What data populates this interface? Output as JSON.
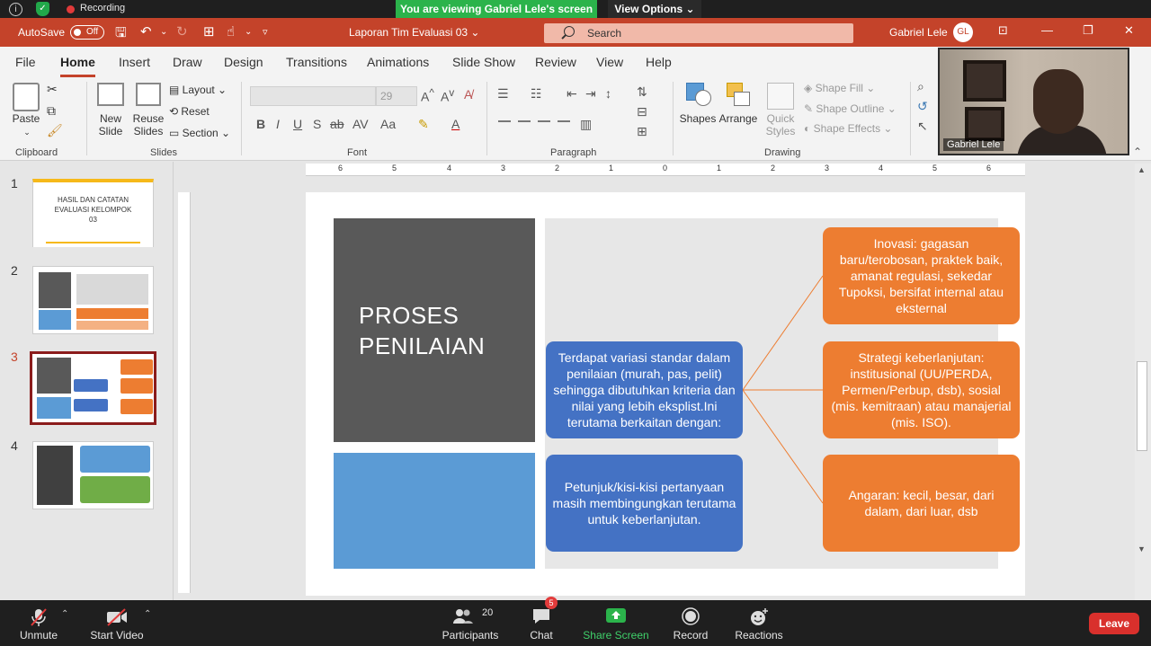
{
  "zoom": {
    "recording_label": "Recording",
    "viewing_banner": "You are viewing Gabriel Lele's screen",
    "view_options": "View Options",
    "toolbar": {
      "unmute": "Unmute",
      "start_video": "Start Video",
      "participants": "Participants",
      "participants_count": "20",
      "chat": "Chat",
      "chat_badge": "5",
      "share_screen": "Share Screen",
      "record": "Record",
      "reactions": "Reactions",
      "leave": "Leave"
    },
    "webcam_name": "Gabriel Lele"
  },
  "ppt": {
    "autosave_label": "AutoSave",
    "autosave_state": "Off",
    "doc_title": "Laporan Tim Evaluasi 03",
    "search_placeholder": "Search",
    "user_name": "Gabriel Lele",
    "user_initials": "GL",
    "tabs": [
      "File",
      "Home",
      "Insert",
      "Draw",
      "Design",
      "Transitions",
      "Animations",
      "Slide Show",
      "Review",
      "View",
      "Help"
    ],
    "ribbon": {
      "paste": "Paste",
      "new_slide": "New Slide",
      "reuse_slides": "Reuse Slides",
      "layout": "Layout",
      "reset": "Reset",
      "section": "Section",
      "font_size": "29",
      "shapes": "Shapes",
      "arrange": "Arrange",
      "quick_styles": "Quick Styles",
      "shape_fill": "Shape Fill",
      "shape_outline": "Shape Outline",
      "shape_effects": "Shape Effects",
      "groups": {
        "clipboard": "Clipboard",
        "slides": "Slides",
        "font": "Font",
        "paragraph": "Paragraph",
        "drawing": "Drawing"
      }
    },
    "slides": [
      {
        "num": "1",
        "title": "HASIL DAN CATATAN EVALUASI KELOMPOK 03"
      },
      {
        "num": "2"
      },
      {
        "num": "3"
      },
      {
        "num": "4"
      }
    ],
    "current_slide": {
      "title": "PROSES PENILAIAN",
      "box_center": "Terdapat variasi standar dalam penilaian (murah, pas, pelit) sehingga dibutuhkan kriteria dan nilai yang lebih eksplist.Ini terutama berkaitan dengan:",
      "box_bottom": "Petunjuk/kisi-kisi pertanyaan masih membingungkan terutama untuk keberlanjutan.",
      "box_r1": "Inovasi: gagasan baru/terobosan, praktek baik, amanat regulasi, sekedar Tupoksi, bersifat internal atau eksternal",
      "box_r2": "Strategi keberlanjutan: institusional (UU/PERDA, Permen/Perbup, dsb), sosial (mis. kemitraan) atau manajerial (mis. ISO).",
      "box_r3": "Angaran: kecil, besar, dari dalam, dari luar, dsb"
    },
    "ruler_top_labels": [
      "6",
      "5",
      "4",
      "3",
      "2",
      "1",
      "0",
      "1",
      "2",
      "3",
      "4",
      "5",
      "6"
    ]
  },
  "colors": {
    "ppt_accent": "#c4432a",
    "slide_dark": "#595959",
    "slide_blue": "#5b9bd5",
    "box_blue": "#4472c4",
    "box_orange": "#ed7d31",
    "zoom_green": "#2bb34b",
    "leave_red": "#d9302c"
  }
}
